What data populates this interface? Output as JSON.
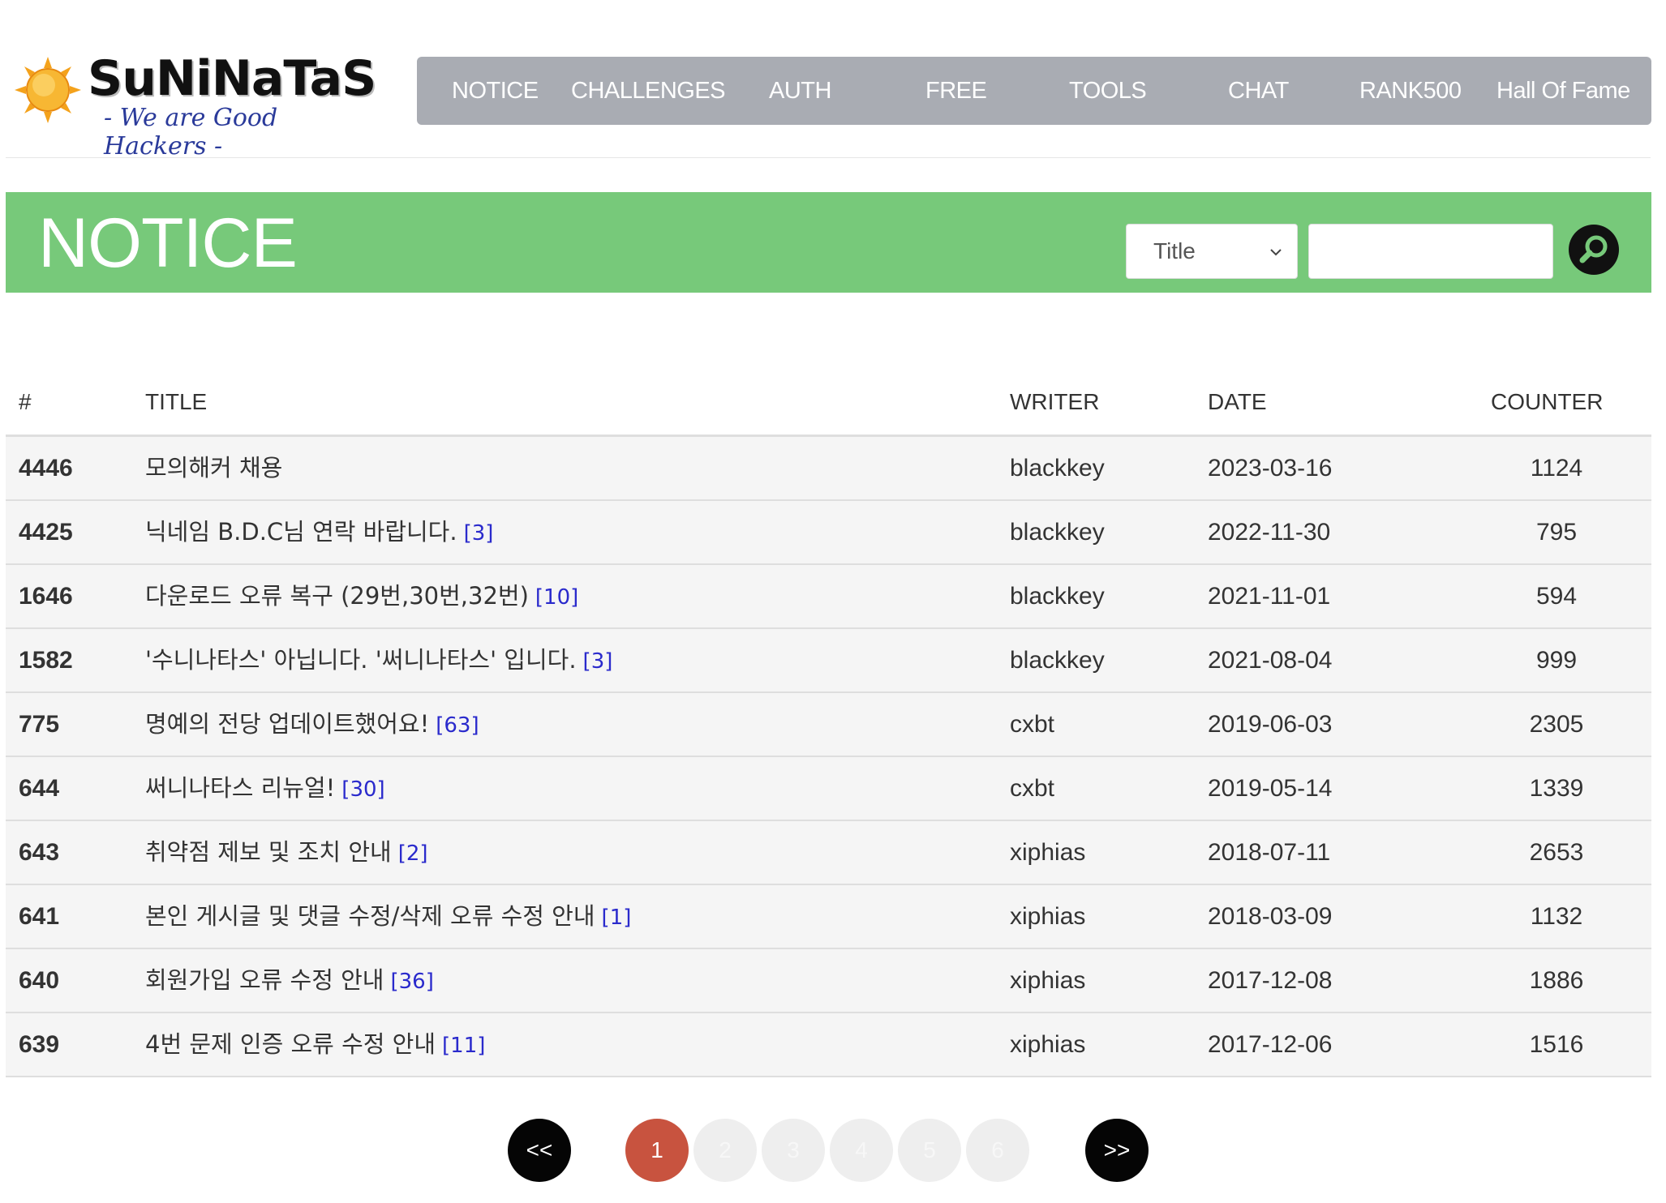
{
  "logo": {
    "title": "SuNiNaTaS",
    "subtitle": "- We are Good Hackers -"
  },
  "nav": {
    "items": [
      {
        "label": "NOTICE"
      },
      {
        "label": "CHALLENGES"
      },
      {
        "label": "AUTH"
      },
      {
        "label": "FREE"
      },
      {
        "label": "TOOLS"
      },
      {
        "label": "CHAT"
      },
      {
        "label": "RANK500"
      },
      {
        "label": "Hall Of Fame"
      }
    ]
  },
  "banner": {
    "title": "NOTICE",
    "search_field_selected": "Title",
    "search_value": "",
    "search_icon": "search-icon",
    "color": "#77c97a"
  },
  "table": {
    "headers": {
      "num": "#",
      "title": "TITLE",
      "writer": "WRITER",
      "date": "DATE",
      "counter": "COUNTER"
    },
    "rows": [
      {
        "num": "4446",
        "title": "모의해커 채용",
        "comments": "",
        "writer": "blackkey",
        "date": "2023-03-16",
        "counter": "1124"
      },
      {
        "num": "4425",
        "title": "닉네임 B.D.C님 연락 바랍니다.",
        "comments": "[3]",
        "writer": "blackkey",
        "date": "2022-11-30",
        "counter": "795"
      },
      {
        "num": "1646",
        "title": "다운로드 오류 복구 (29번,30번,32번)",
        "comments": "[10]",
        "writer": "blackkey",
        "date": "2021-11-01",
        "counter": "594"
      },
      {
        "num": "1582",
        "title": "'수니나타스' 아닙니다. '써니나타스' 입니다.",
        "comments": "[3]",
        "writer": "blackkey",
        "date": "2021-08-04",
        "counter": "999"
      },
      {
        "num": "775",
        "title": "명예의 전당 업데이트했어요!",
        "comments": "[63]",
        "writer": "cxbt",
        "date": "2019-06-03",
        "counter": "2305"
      },
      {
        "num": "644",
        "title": "써니나타스 리뉴얼!",
        "comments": "[30]",
        "writer": "cxbt",
        "date": "2019-05-14",
        "counter": "1339"
      },
      {
        "num": "643",
        "title": "취약점 제보 및 조치 안내",
        "comments": "[2]",
        "writer": "xiphias",
        "date": "2018-07-11",
        "counter": "2653"
      },
      {
        "num": "641",
        "title": "본인 게시글 및 댓글 수정/삭제 오류 수정 안내",
        "comments": "[1]",
        "writer": "xiphias",
        "date": "2018-03-09",
        "counter": "1132"
      },
      {
        "num": "640",
        "title": "회원가입 오류 수정 안내",
        "comments": "[36]",
        "writer": "xiphias",
        "date": "2017-12-08",
        "counter": "1886"
      },
      {
        "num": "639",
        "title": "4번 문제 인증 오류 수정 안내",
        "comments": "[11]",
        "writer": "xiphias",
        "date": "2017-12-06",
        "counter": "1516"
      }
    ]
  },
  "pagination": {
    "prev": "<<",
    "next": ">>",
    "pages": [
      "1",
      "2",
      "3",
      "4",
      "5",
      "6"
    ],
    "current": "1",
    "active_color": "#c8533f"
  }
}
